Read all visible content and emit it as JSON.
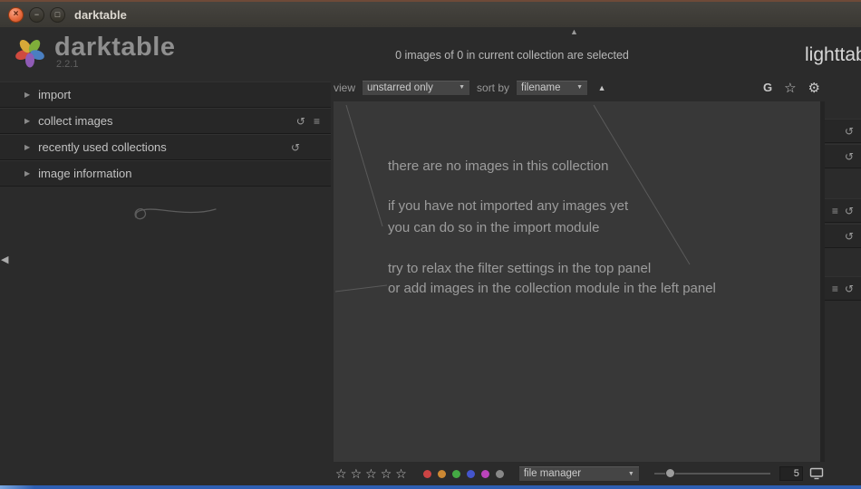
{
  "window": {
    "title": "darktable",
    "buttons": {
      "close": "×",
      "minimize": "−",
      "maximize": "□"
    }
  },
  "icons": {
    "expander": "▶",
    "dropdown_arrow": "▼",
    "panel_collapse_up": "▲",
    "panel_collapse_left": "◀",
    "sort_ascending": "▲",
    "group": "G",
    "star_outline": "☆",
    "gear": "⚙",
    "reset": "↺",
    "presets": "≡"
  },
  "brand": {
    "name": "darktable",
    "version": "2.2.1"
  },
  "left_panel": {
    "sections": [
      {
        "label": "import"
      },
      {
        "label": "collect images"
      },
      {
        "label": "recently used collections"
      },
      {
        "label": "image information"
      }
    ]
  },
  "top_bar": {
    "status": "0 images of 0 in current collection are selected",
    "view_label": "view",
    "view_value": "unstarred only",
    "sort_label": "sort by",
    "sort_value": "filename",
    "mode": "lighttable"
  },
  "center": {
    "messages": [
      "there are no images in this collection",
      "if you have not imported any images yet",
      "you can do so in the import module",
      "try to relax the filter settings in the top panel",
      "or add images in the collection module in the left panel"
    ]
  },
  "bottom_bar": {
    "star_count": 5,
    "color_labels": [
      "#cc4444",
      "#cc8833",
      "#44aa44",
      "#4455cc",
      "#bb44bb",
      "#888888"
    ],
    "layout_value": "file manager",
    "zoom_level": "5"
  }
}
